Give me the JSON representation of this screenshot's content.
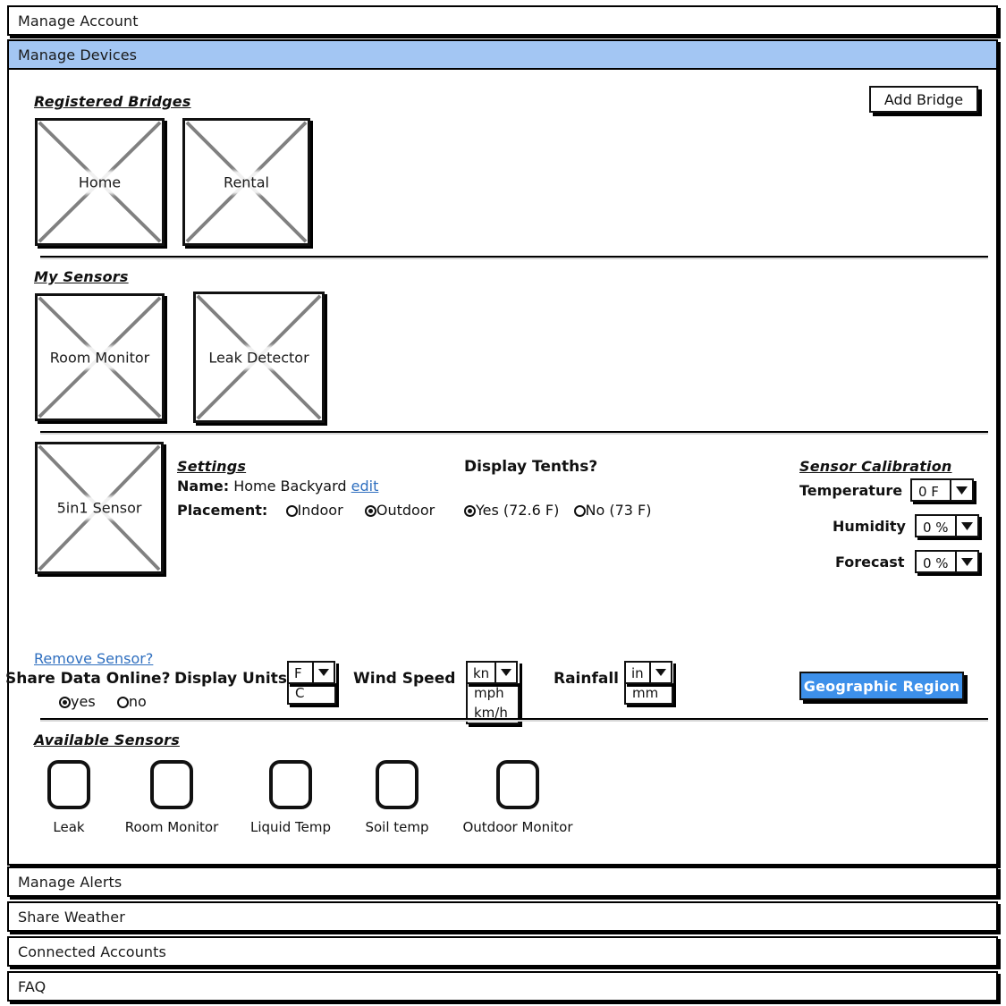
{
  "accordion": {
    "rows": [
      {
        "label": "Manage Account",
        "active": false
      },
      {
        "label": "Manage Devices",
        "active": true
      }
    ],
    "footer_rows": [
      {
        "label": "Manage Alerts"
      },
      {
        "label": "Share Weather"
      },
      {
        "label": "Connected Accounts"
      },
      {
        "label": "FAQ"
      }
    ]
  },
  "registered_bridges": {
    "title": "Registered Bridges",
    "add_button": "Add Bridge",
    "items": [
      {
        "caption": "Home"
      },
      {
        "caption": "Rental"
      }
    ]
  },
  "my_sensors": {
    "title": "My Sensors",
    "items": [
      {
        "caption": "Room Monitor"
      },
      {
        "caption": "Leak Detector"
      }
    ]
  },
  "selected_sensor": {
    "caption": "5in1 Sensor",
    "remove_link": "Remove Sensor?"
  },
  "settings": {
    "title": "Settings",
    "name_label": "Name:",
    "name_value": "Home Backyard",
    "name_edit_link": "edit",
    "placement_label": "Placement:",
    "placement_options": [
      {
        "label": "Indoor",
        "selected": false
      },
      {
        "label": "Outdoor",
        "selected": true
      }
    ]
  },
  "display_tenths": {
    "title": "Display Tenths?",
    "options": [
      {
        "label": "Yes (72.6 F)",
        "selected": true
      },
      {
        "label": "No (73 F)",
        "selected": false
      }
    ]
  },
  "sensor_calibration": {
    "title": "Sensor Calibration",
    "fields": [
      {
        "label": "Temperature",
        "value": "0 F"
      },
      {
        "label": "Humidity",
        "value": "0 %"
      },
      {
        "label": "Forecast",
        "value": "0 %"
      }
    ]
  },
  "share_data": {
    "label": "Share Data Online?",
    "options": [
      {
        "label": "yes",
        "selected": true
      },
      {
        "label": "no",
        "selected": false
      }
    ]
  },
  "unit_pickers": {
    "display_units": {
      "label": "Display Units",
      "value": "F",
      "options": [
        "C"
      ]
    },
    "wind_speed": {
      "label": "Wind Speed",
      "value": "kn",
      "options": [
        "mph",
        "km/h"
      ]
    },
    "rainfall": {
      "label": "Rainfall",
      "value": "in",
      "options": [
        "mm"
      ]
    }
  },
  "geographic_region_button": "Geographic Region",
  "available_sensors": {
    "title": "Available Sensors",
    "items": [
      {
        "label": "Leak"
      },
      {
        "label": "Room Monitor"
      },
      {
        "label": "Liquid Temp"
      },
      {
        "label": "Soil temp"
      },
      {
        "label": "Outdoor Monitor"
      }
    ]
  },
  "colors": {
    "active_row": "#a3c6f3",
    "primary_button": "#3d90ea",
    "link": "#2f6fbf",
    "outline": "#111111"
  }
}
